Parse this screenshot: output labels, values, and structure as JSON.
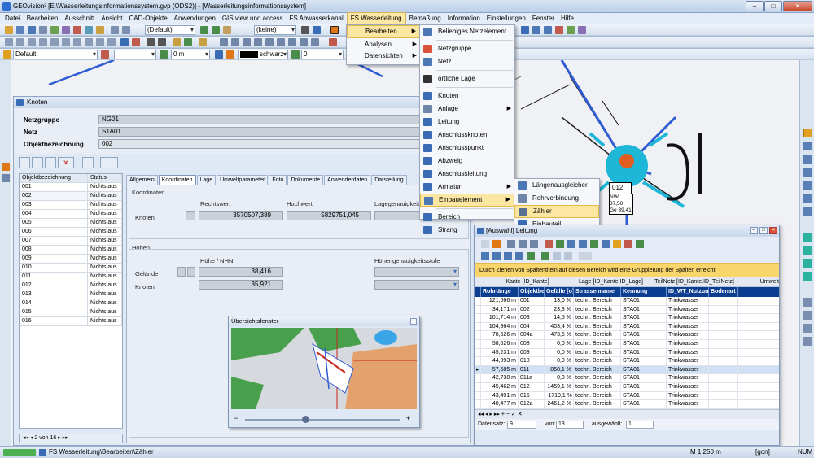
{
  "window": {
    "title": "GEOvision³ [E:\\Wasserleitungsinformationssystem.gvp (ODS2)] - [Wasserleitungsinformationssystem]"
  },
  "menubar": [
    "Datei",
    "Bearbeiten",
    "Ausschnitt",
    "Ansicht",
    "CAD-Objekte",
    "Anwendungen",
    "GIS view und access",
    "FS Abwasserkanal",
    "FS Wasserleitung",
    "Bemaßung",
    "Information",
    "Einstellungen",
    "Fenster",
    "Hilfe"
  ],
  "toolbar": {
    "scale_combo": "(Default)",
    "layer_combo": "(keine)",
    "style_combo": "Default",
    "offset_value": "0 m",
    "color_label": "schwarz",
    "width_value": "0"
  },
  "menu_fs": {
    "items": [
      "Bearbeiten",
      "Analysen",
      "Datensichten"
    ]
  },
  "menu_bearbeiten": {
    "items": [
      "Beliebiges Netzelement",
      "Netzgruppe",
      "Netz",
      "örtliche Lage",
      "Knoten",
      "Anlage",
      "Leitung",
      "Anschlussknoten",
      "Anschlusspunkt",
      "Abzweig",
      "Anschlussleitung",
      "Armatur",
      "Einbauelement",
      "Bereich",
      "Strang"
    ]
  },
  "menu_einbau": {
    "items": [
      "Längenausgleicher",
      "Rohrverbindung",
      "Zähler",
      "Einbauteil"
    ]
  },
  "knoten": {
    "title": "Knoten",
    "netzgruppe_label": "Netzgruppe",
    "netzgruppe_value": "NG01",
    "netz_label": "Netz",
    "netz_value": "STA01",
    "objbez_label": "Objektbezeichnung",
    "objbez_value": "002",
    "grid_headers": [
      "Objektbezeichnung",
      "Status"
    ],
    "grid_rows": [
      [
        "001",
        "Nichts aus"
      ],
      [
        "002",
        "Nichts aus"
      ],
      [
        "003",
        "Nichts aus"
      ],
      [
        "004",
        "Nichts aus"
      ],
      [
        "005",
        "Nichts aus"
      ],
      [
        "006",
        "Nichts aus"
      ],
      [
        "007",
        "Nichts aus"
      ],
      [
        "008",
        "Nichts aus"
      ],
      [
        "009",
        "Nichts aus"
      ],
      [
        "010",
        "Nichts aus"
      ],
      [
        "011",
        "Nichts aus"
      ],
      [
        "012",
        "Nichts aus"
      ],
      [
        "013",
        "Nichts aus"
      ],
      [
        "014",
        "Nichts aus"
      ],
      [
        "015",
        "Nichts aus"
      ],
      [
        "016",
        "Nichts aus"
      ]
    ],
    "pager": "2 von 16",
    "tabs": [
      "Allgemein",
      "Koordinaten",
      "Lage",
      "Umweltparameter",
      "Foto",
      "Dokumente",
      "Anwenderdaten",
      "Darstellung"
    ],
    "koord_group": "Koordinaten",
    "rechtswert_label": "Rechtswert",
    "hochwert_label": "Hochwert",
    "lage_label": "Lagegenauigkeitsstufe",
    "knoten_label": "Knoten",
    "rechtswert": "3570507,389",
    "hochwert": "5829751,045",
    "hoehen_group": "Höhen",
    "hoehe_label": "Höhe / NHN",
    "hoehe_genau_label": "Höhengenauigkeitsstufe",
    "gelaende_label": "Gelände",
    "gelaende_value": "38,416",
    "knoten2_label": "Knoten",
    "knoten2_value": "35,921"
  },
  "uebersicht": {
    "title": "Übersichtsfenster"
  },
  "map_labels": {
    "node": "012",
    "nw": "NW 37,50",
    "ge": "Ge 39,41"
  },
  "auswahl": {
    "title": "[Auswahl] Leitung",
    "group_hint": "Durch Ziehen von Spaltentiteln auf diesen Bereich wird eine Gruppierung der Spalten erreicht",
    "band_headers": [
      "Kante [ID_Kante]",
      "Lage [ID_Kante.ID_Lage]",
      "TeilNetz [ID_Kante.ID_TeilNetz]",
      "Umwelt"
    ],
    "headers": [
      "Rohrlänge",
      "Objektbez",
      "Gefälle [o]",
      "Strassenname",
      "Kennung",
      "ID_WT_Nutzun",
      "Bodenart"
    ],
    "rows": [
      [
        "121,066 m",
        "001",
        "13,0 %",
        "techn. Bereich",
        "STA01",
        "Trinkwasser",
        ""
      ],
      [
        "34,171 m",
        "002",
        "23,3 %",
        "techn. Bereich",
        "STA01",
        "Trinkwasser",
        ""
      ],
      [
        "101,714 m",
        "003",
        "14,5 %",
        "techn. Bereich",
        "STA01",
        "Trinkwasser",
        ""
      ],
      [
        "104,964 m",
        "004",
        "403,4 %",
        "techn. Bereich",
        "STA01",
        "Trinkwasser",
        ""
      ],
      [
        "78,626 m",
        "004a",
        "473,6 %",
        "techn. Bereich",
        "STA01",
        "Trinkwasser",
        ""
      ],
      [
        "58,026 m",
        "008",
        "0,0 %",
        "techn. Bereich",
        "STA01",
        "Trinkwasser",
        ""
      ],
      [
        "45,231 m",
        "009",
        "0,0 %",
        "techn. Bereich",
        "STA01",
        "Trinkwasser",
        ""
      ],
      [
        "44,093 m",
        "010",
        "0,0 %",
        "techn. Bereich",
        "STA01",
        "Trinkwasser",
        ""
      ],
      [
        "57,585 m",
        "011",
        "-858,1 %",
        "techn. Bereich",
        "STA01",
        "Trinkwasser",
        ""
      ],
      [
        "42,738 m",
        "011a",
        "0,0 %",
        "techn. Bereich",
        "STA01",
        "Trinkwasser",
        ""
      ],
      [
        "45,462 m",
        "012",
        "1459,1 %",
        "techn. Bereich",
        "STA01",
        "Trinkwasser",
        ""
      ],
      [
        "43,491 m",
        "015",
        "-1710,1 %",
        "techn. Bereich",
        "STA01",
        "Trinkwasser",
        ""
      ],
      [
        "40,477 m",
        "012a",
        "2461,2 %",
        "techn. Bereich",
        "STA01",
        "Trinkwasser",
        ""
      ]
    ],
    "footer_datensatz": "Datensatz:",
    "footer_value": "9",
    "footer_von": "von:",
    "footer_total": "13",
    "footer_ausgewaehlt": "ausgewählt:",
    "footer_sel": "1"
  },
  "status": {
    "path": "FS Wasserleitung\\Bearbeiten\\Zähler",
    "scale": "M 1:250  m",
    "gon": "[gon]",
    "num": "NUM"
  }
}
